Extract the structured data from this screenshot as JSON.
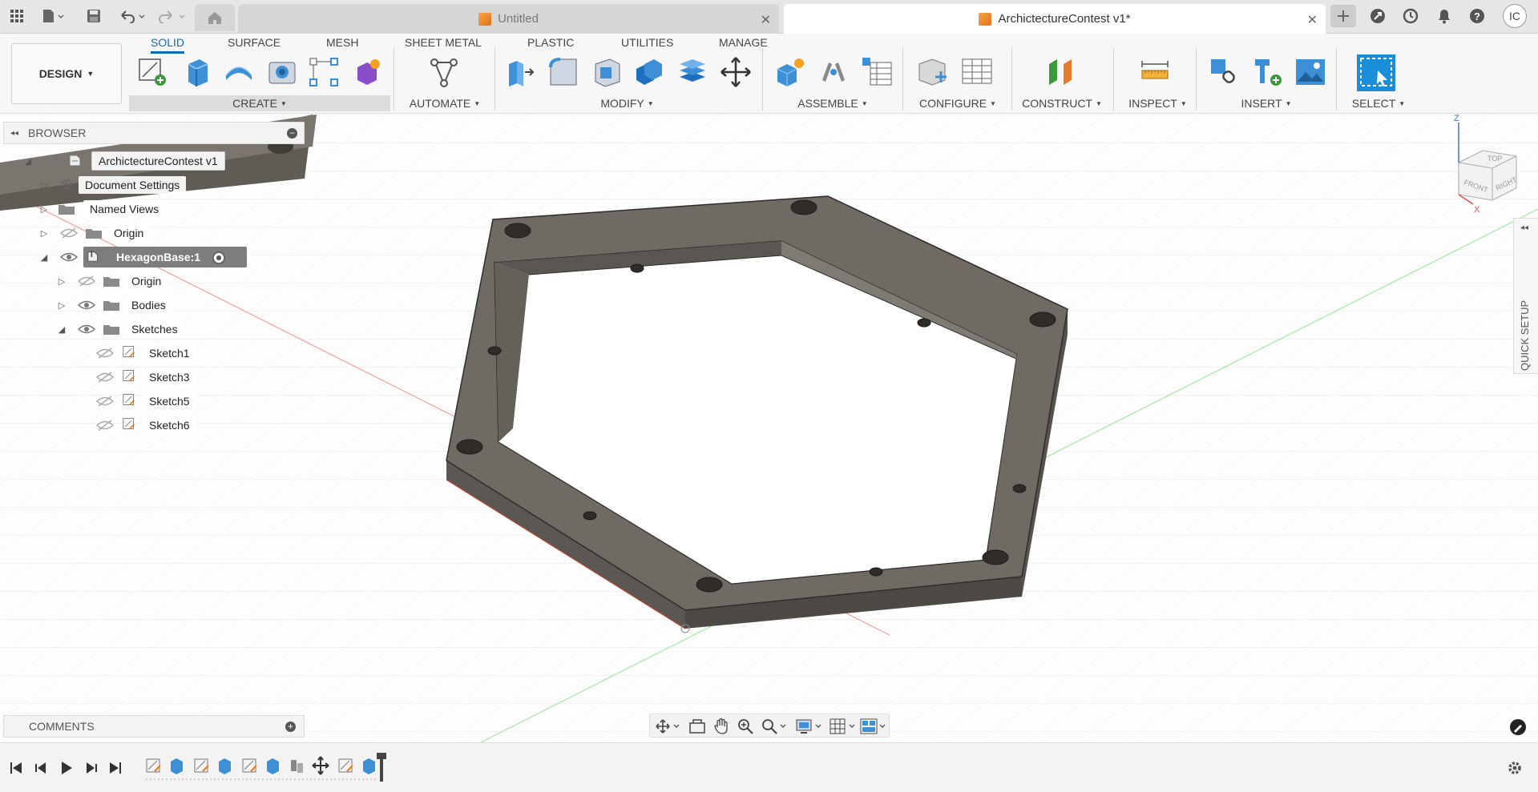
{
  "titlebar": {
    "tabs": [
      {
        "label": "Untitled",
        "active": false
      },
      {
        "label": "ArchictectureContest v1*",
        "active": true
      }
    ],
    "user_initials": "IC"
  },
  "toolbar": {
    "workspace": "DESIGN",
    "menu_tabs": [
      "SOLID",
      "SURFACE",
      "MESH",
      "SHEET METAL",
      "PLASTIC",
      "UTILITIES",
      "MANAGE"
    ],
    "active_tab": "SOLID",
    "groups": [
      "CREATE",
      "AUTOMATE",
      "MODIFY",
      "ASSEMBLE",
      "CONFIGURE",
      "CONSTRUCT",
      "INSPECT",
      "INSERT",
      "SELECT"
    ]
  },
  "browser": {
    "title": "BROWSER",
    "root": "ArchictectureContest v1",
    "items": [
      {
        "label": "Document Settings"
      },
      {
        "label": "Named Views"
      },
      {
        "label": "Origin"
      },
      {
        "label": "HexagonBase:1"
      },
      {
        "label": "Origin"
      },
      {
        "label": "Bodies"
      },
      {
        "label": "Sketches"
      },
      {
        "label": "Sketch1"
      },
      {
        "label": "Sketch3"
      },
      {
        "label": "Sketch5"
      },
      {
        "label": "Sketch6"
      }
    ]
  },
  "viewcube": {
    "top": "TOP",
    "front": "FRONT",
    "right": "RIGHT",
    "axis_z": "Z",
    "axis_x": "X"
  },
  "quick_setup": "QUICK SETUP",
  "comments": {
    "title": "COMMENTS"
  },
  "colors": {
    "accent": "#0a6ebd",
    "model": "#6b6761",
    "model_top": "#7a756f"
  }
}
